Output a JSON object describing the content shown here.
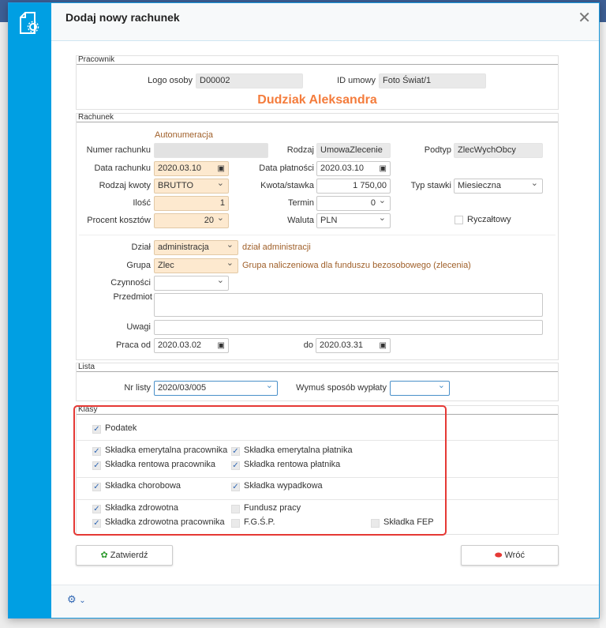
{
  "dialog": {
    "title": "Dodaj nowy rachunek",
    "close_icon": "close-icon",
    "side_icon": "document-gear-icon"
  },
  "pracownik": {
    "header": "Pracownik",
    "logo_label": "Logo osoby",
    "logo_value": "D00002",
    "id_label": "ID umowy",
    "id_value": "Foto Świat/1",
    "name": "Dudziak Aleksandra"
  },
  "rachunek": {
    "header": "Rachunek",
    "autonumeracja": "Autonumeracja",
    "numer_label": "Numer rachunku",
    "numer_value": "",
    "rodzaj_label": "Rodzaj",
    "rodzaj_value": "UmowaZlecenie",
    "podtyp_label": "Podtyp",
    "podtyp_value": "ZlecWychObcy",
    "data_label": "Data rachunku",
    "data_value": "2020.03.10",
    "platnosc_label": "Data płatności",
    "platnosc_value": "2020.03.10",
    "kwota_rodzaj_label": "Rodzaj kwoty",
    "kwota_rodzaj_value": "BRUTTO",
    "kwota_label": "Kwota/stawka",
    "kwota_value": "1 750,00",
    "typ_label": "Typ stawki",
    "typ_value": "Miesieczna",
    "ilosc_label": "Ilość",
    "ilosc_value": "1",
    "termin_label": "Termin",
    "termin_value": "0",
    "procent_label": "Procent kosztów",
    "procent_value": "20",
    "waluta_label": "Waluta",
    "waluta_value": "PLN",
    "ryczaltowy_label": "Ryczałtowy",
    "ryczaltowy_checked": false,
    "dzial_label": "Dział",
    "dzial_value": "administracja",
    "dzial_note": "dział administracji",
    "grupa_label": "Grupa",
    "grupa_value": "Zlec",
    "grupa_note": "Grupa naliczeniowa dla funduszu bezosobowego (zlecenia)",
    "czynnosci_label": "Czynności",
    "czynnosci_value": "",
    "przedmiot_label": "Przedmiot",
    "przedmiot_value": "",
    "uwagi_label": "Uwagi",
    "uwagi_value": "",
    "praca_od_label": "Praca od",
    "praca_od_value": "2020.03.02",
    "do_label": "do",
    "do_value": "2020.03.31"
  },
  "lista": {
    "header": "Lista",
    "nr_label": "Nr listy",
    "nr_value": "2020/03/005",
    "wymus_label": "Wymuś sposób wypłaty",
    "wymus_value": ""
  },
  "klasy": {
    "header": "Klasy",
    "items": [
      {
        "label": "Podatek",
        "checked": true
      },
      {
        "label": "Składka emerytalna pracownika",
        "checked": true
      },
      {
        "label": "Składka emerytalna płatnika",
        "checked": true
      },
      {
        "label": "Składka rentowa pracownika",
        "checked": true
      },
      {
        "label": "Składka rentowa płatnika",
        "checked": true
      },
      {
        "label": "Składka chorobowa",
        "checked": true
      },
      {
        "label": "Składka wypadkowa",
        "checked": true
      },
      {
        "label": "Składka zdrowotna",
        "checked": true
      },
      {
        "label": "Fundusz pracy",
        "checked": false
      },
      {
        "label": "Składka zdrowotna pracownika",
        "checked": true
      },
      {
        "label": "F.G.Ś.P.",
        "checked": false
      },
      {
        "label": "Składka FEP",
        "checked": false
      }
    ]
  },
  "buttons": {
    "confirm": "Zatwierdź",
    "back": "Wróć"
  },
  "colors": {
    "accent": "#009fe3",
    "name": "#f47c3c",
    "required_bg": "#fde9cf",
    "highlight": "#e53935"
  }
}
